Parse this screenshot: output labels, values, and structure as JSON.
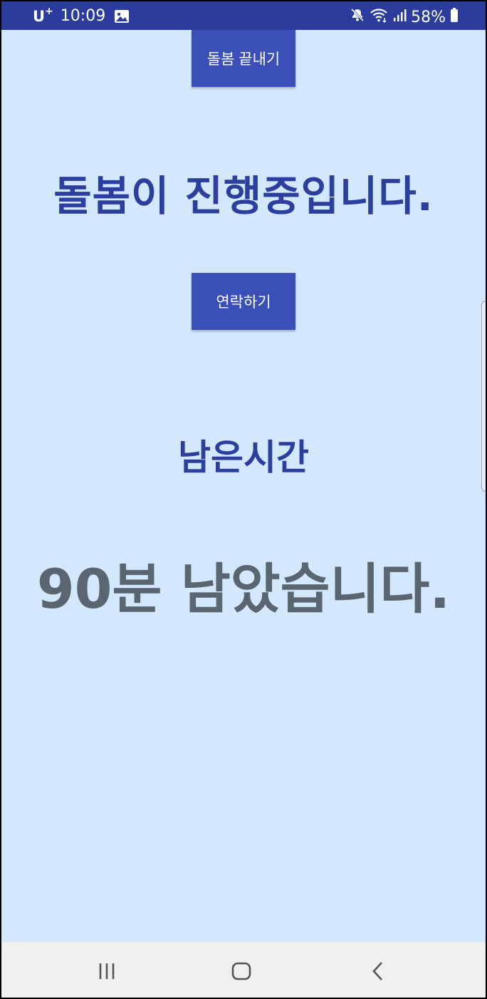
{
  "status_bar": {
    "carrier": "U",
    "carrier_plus": "+",
    "time": "10:09",
    "battery": "58%",
    "icons": [
      "gallery-icon",
      "mute-icon",
      "wifi-icon",
      "signal-icon",
      "battery-icon"
    ],
    "background_color": "#2c3c9c"
  },
  "main": {
    "end_care_button": "돌봄 끝내기",
    "care_in_progress": "돌봄이 진행중입니다.",
    "contact_button": "연락하기",
    "remaining_label": "남은시간",
    "remaining_time": "90분 남았습니다.",
    "background_color": "#d3e7fd",
    "accent_color": "#3b4fb8"
  },
  "nav_bar": {
    "icons": [
      "recent-apps-icon",
      "home-icon",
      "back-icon"
    ]
  }
}
